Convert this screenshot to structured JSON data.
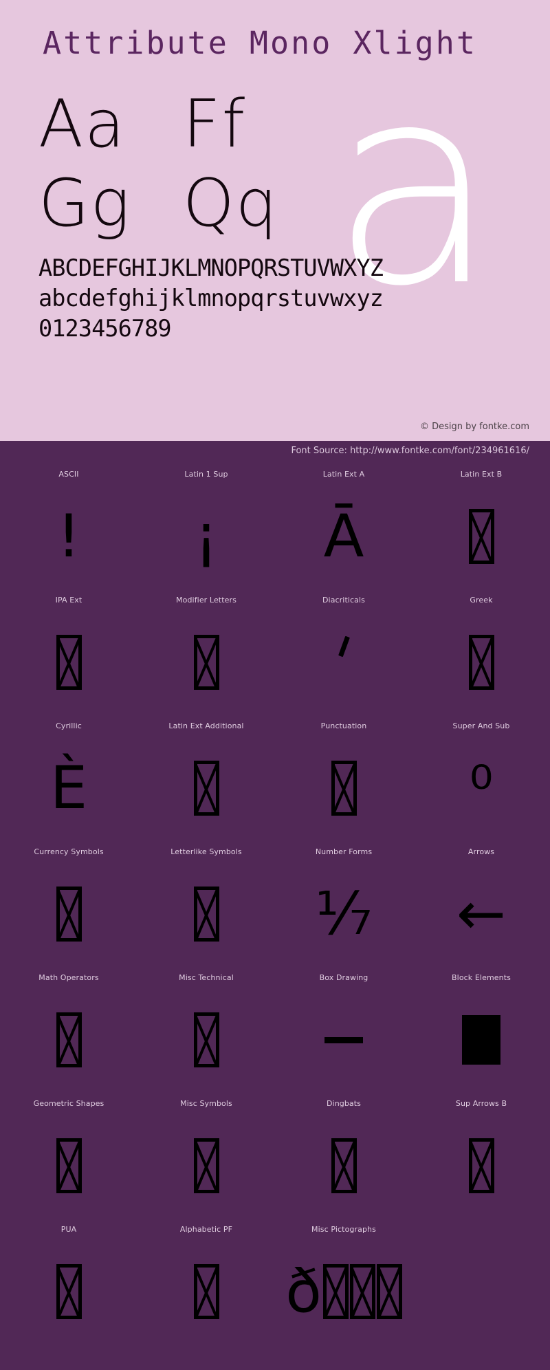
{
  "specimen": {
    "title": "Attribute Mono Xlight",
    "watermark_letter": "a",
    "letter_pairs": [
      "Aa",
      "Ff",
      "Gg",
      "Qq"
    ],
    "alphabet_upper": "ABCDEFGHIJKLMNOPQRSTUVWXYZ",
    "alphabet_lower": "abcdefghijklmnopqrstuvwxyz",
    "digits": "0123456789",
    "design_credit": "© Design by fontke.com",
    "font_source": "Font Source: http://www.fontke.com/font/234961616/"
  },
  "colors": {
    "specimen_background": "#e6c7de",
    "coverage_background": "#512856",
    "title_text": "#5b2660",
    "specimen_text": "#14080f",
    "watermark": "#ffffff",
    "block_label_text": "#e0cde0",
    "glyph": "#000000",
    "credit_text": "#4c4248",
    "source_text": "#dcc8dd"
  },
  "coverage_blocks": [
    {
      "label": "ASCII",
      "glyph": "!",
      "kind": "text"
    },
    {
      "label": "Latin 1 Sup",
      "glyph": "¡",
      "kind": "text"
    },
    {
      "label": "Latin Ext A",
      "glyph": "Ā",
      "kind": "text"
    },
    {
      "label": "Latin Ext B",
      "glyph": "",
      "kind": "notdef",
      "count": 1
    },
    {
      "label": "IPA Ext",
      "glyph": "",
      "kind": "notdef",
      "count": 1
    },
    {
      "label": "Modifier Letters",
      "glyph": "",
      "kind": "notdef",
      "count": 1
    },
    {
      "label": "Diacriticals",
      "glyph": "",
      "kind": "accent"
    },
    {
      "label": "Greek",
      "glyph": "",
      "kind": "notdef",
      "count": 1
    },
    {
      "label": "Cyrillic",
      "glyph": "È",
      "kind": "text"
    },
    {
      "label": "Latin Ext Additional",
      "glyph": "",
      "kind": "notdef",
      "count": 1
    },
    {
      "label": "Punctuation",
      "glyph": "",
      "kind": "notdef",
      "count": 1
    },
    {
      "label": "Super And Sub",
      "glyph": "⁰",
      "kind": "text"
    },
    {
      "label": "Currency Symbols",
      "glyph": "",
      "kind": "notdef",
      "count": 1
    },
    {
      "label": "Letterlike Symbols",
      "glyph": "",
      "kind": "notdef",
      "count": 1
    },
    {
      "label": "Number Forms",
      "glyph": "⅐",
      "kind": "text"
    },
    {
      "label": "Arrows",
      "glyph": "←",
      "kind": "text"
    },
    {
      "label": "Math Operators",
      "glyph": "",
      "kind": "notdef",
      "count": 1
    },
    {
      "label": "Misc Technical",
      "glyph": "",
      "kind": "notdef",
      "count": 1
    },
    {
      "label": "Box Drawing",
      "glyph": "",
      "kind": "rule"
    },
    {
      "label": "Block Elements",
      "glyph": "",
      "kind": "solid"
    },
    {
      "label": "Geometric Shapes",
      "glyph": "",
      "kind": "notdef",
      "count": 1
    },
    {
      "label": "Misc Symbols",
      "glyph": "",
      "kind": "notdef",
      "count": 1
    },
    {
      "label": "Dingbats",
      "glyph": "",
      "kind": "notdef",
      "count": 1
    },
    {
      "label": "Sup Arrows B",
      "glyph": "",
      "kind": "notdef",
      "count": 1
    },
    {
      "label": "PUA",
      "glyph": "",
      "kind": "notdef",
      "count": 1
    },
    {
      "label": "Alphabetic PF",
      "glyph": "",
      "kind": "notdef",
      "count": 1
    },
    {
      "label": "Misc Pictographs",
      "glyph": "ð",
      "kind": "text-notdef",
      "count": 3
    },
    {
      "label": "",
      "glyph": "",
      "kind": "empty"
    }
  ]
}
